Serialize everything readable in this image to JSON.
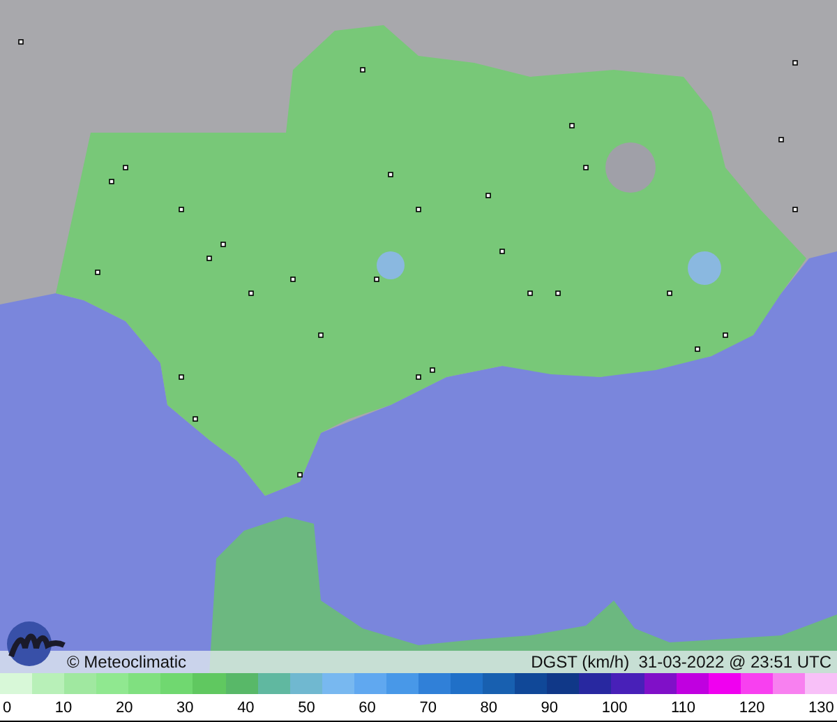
{
  "caption": {
    "credit": "© Meteoclimatic",
    "title": "DGST (km/h)  31-03-2022 @ 23:51 UTC"
  },
  "scale": {
    "segments": [
      {
        "color": "#d8f8d8"
      },
      {
        "color": "#b8f0b8"
      },
      {
        "color": "#a0e8a0"
      },
      {
        "color": "#90e890"
      },
      {
        "color": "#80e080"
      },
      {
        "color": "#70d870"
      },
      {
        "color": "#60c860"
      },
      {
        "color": "#58b868"
      },
      {
        "color": "#60b8a0"
      },
      {
        "color": "#70b8d0"
      },
      {
        "color": "#78b8f0"
      },
      {
        "color": "#60a8f0"
      },
      {
        "color": "#4898e8"
      },
      {
        "color": "#3080d8"
      },
      {
        "color": "#2070c8"
      },
      {
        "color": "#1860b0"
      },
      {
        "color": "#104898"
      },
      {
        "color": "#103888"
      },
      {
        "color": "#2828a0"
      },
      {
        "color": "#4820b8"
      },
      {
        "color": "#8010c8"
      },
      {
        "color": "#c000e0"
      },
      {
        "color": "#f000f0"
      },
      {
        "color": "#f840f0"
      },
      {
        "color": "#f880f0"
      },
      {
        "color": "#f8c0f8"
      }
    ],
    "ticks": [
      "0",
      "10",
      "20",
      "30",
      "40",
      "50",
      "60",
      "70",
      "80",
      "90",
      "100",
      "110",
      "120",
      "130"
    ]
  }
}
